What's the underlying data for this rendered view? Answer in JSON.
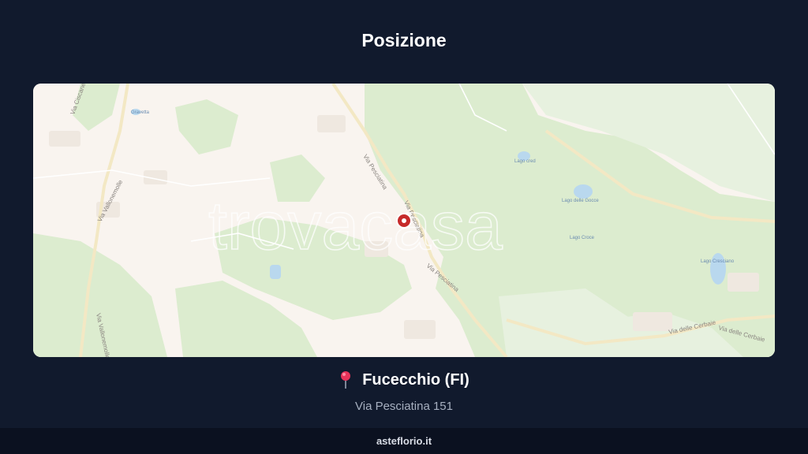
{
  "page": {
    "title": "Posizione",
    "footer": "asteflorio.it"
  },
  "location": {
    "city": "Fucecchio (FI)",
    "address": "Via Pesciatina 151",
    "pin_icon": "round-pushpin-icon"
  },
  "map": {
    "watermark": "trovacasa",
    "marker_icon": "map-marker-icon",
    "roads": [
      "Via Pesciatina",
      "Via Pesciatina",
      "Via Pesciatina",
      "Via Vallonemolle",
      "Via Vallonemolle",
      "Via Ciscanello",
      "Via delle Cerbaie",
      "Via delle Cerbaie"
    ],
    "places": [
      "Lago cred",
      "Lago delle Gocce",
      "Lago Croce",
      "Lago Cresciano",
      "Gravetta"
    ],
    "colors": {
      "land": "#f9f4ef",
      "forest": "#d9ead2",
      "water": "#b9d8ee",
      "marker": "#c62a2a"
    }
  }
}
